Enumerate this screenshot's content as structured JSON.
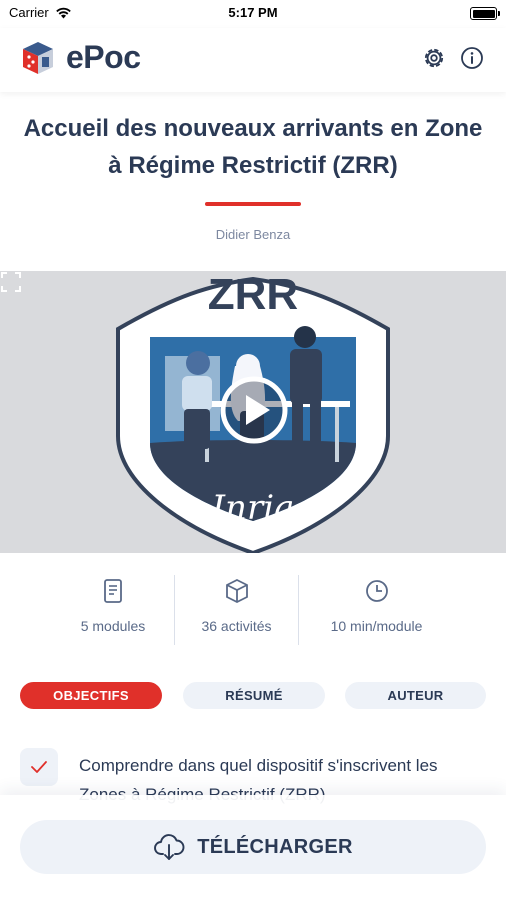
{
  "status_bar": {
    "carrier": "Carrier",
    "time": "5:17 PM"
  },
  "header": {
    "app_name": "ePoc",
    "icons": [
      "settings-icon",
      "info-icon"
    ]
  },
  "course": {
    "title": "Accueil des nouveaux arrivants en Zone à Régime Restrictif (ZRR)",
    "author": "Didier Benza",
    "video": {
      "badge_text": "ZRR",
      "brand_text": "Inria"
    }
  },
  "stats": [
    {
      "icon": "document-icon",
      "label": "5 modules"
    },
    {
      "icon": "cube-icon",
      "label": "36 activités"
    },
    {
      "icon": "clock-icon",
      "label": "10 min/module"
    }
  ],
  "tabs": {
    "objectifs": "OBJECTIFS",
    "resume": "RÉSUMÉ",
    "auteur": "AUTEUR"
  },
  "objectives": [
    {
      "text": "Comprendre dans quel dispositif s'inscrivent les Zones à Régime Restrictif (ZRR)"
    }
  ],
  "download": {
    "label": "TÉLÉCHARGER"
  },
  "colors": {
    "accent": "#e0302a",
    "primary_text": "#2b3a55",
    "pill_bg": "#eef2f8",
    "video_bg": "#d9dadd",
    "shield_blue": "#2f6fa8",
    "shield_dark": "#34425a"
  }
}
